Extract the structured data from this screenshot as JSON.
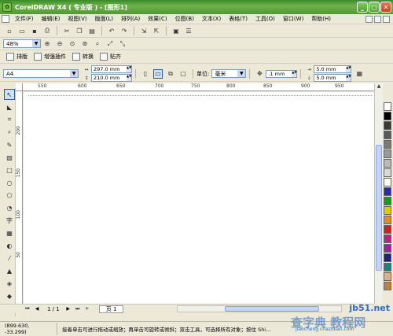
{
  "window": {
    "title": "CorelDRAW X4 ( 专业版 ) - [图形1]"
  },
  "menu": [
    "文件(F)",
    "编辑(E)",
    "视图(V)",
    "版面(L)",
    "排列(A)",
    "效果(C)",
    "位图(B)",
    "文本(X)",
    "表格(T)",
    "工具(O)",
    "窗口(W)",
    "帮助(H)"
  ],
  "zoom": {
    "value": "48%"
  },
  "plugin_bar": {
    "items": [
      "排版",
      "增强插件",
      "转换",
      "贴齐"
    ]
  },
  "property_bar": {
    "paper_size": "A4",
    "width": "297.0 mm",
    "height": "210.0 mm",
    "units_label": "单位:",
    "units_value": "毫米",
    "nudge": ".1 mm",
    "dup_x": "5.0 mm",
    "dup_y": "5.0 mm"
  },
  "ruler": {
    "h_labels": [
      "550",
      "600",
      "650",
      "700",
      "750",
      "800",
      "850",
      "900",
      "950"
    ],
    "v_labels": [
      "200",
      "150",
      "100",
      "50"
    ]
  },
  "page_nav": {
    "counter": "1 / 1",
    "tab": "页 1"
  },
  "palette_colors": [
    "#ffffff",
    "#000000",
    "#3a3a3a",
    "#5a5a5a",
    "#7a7a7a",
    "#9a9a9a",
    "#bababa",
    "#dadada",
    "#ffffff",
    "#2a2aaa",
    "#1a9a1a",
    "#ddcc00",
    "#e09010",
    "#d02020",
    "#c0208a",
    "#a020a0",
    "#202080",
    "#208080",
    "#e0b080",
    "#c08040"
  ],
  "status": {
    "coords": "(899.630, -33.299)",
    "hint": "接着单击可进行拖动或缩放；再单击可旋转或倾斜；双击工具，可选择所有对象；按住 Shi..."
  },
  "watermark": {
    "site": "jb51.net",
    "text": "查字典 教程网",
    "url": "jiaocheng.chazidian.com"
  }
}
